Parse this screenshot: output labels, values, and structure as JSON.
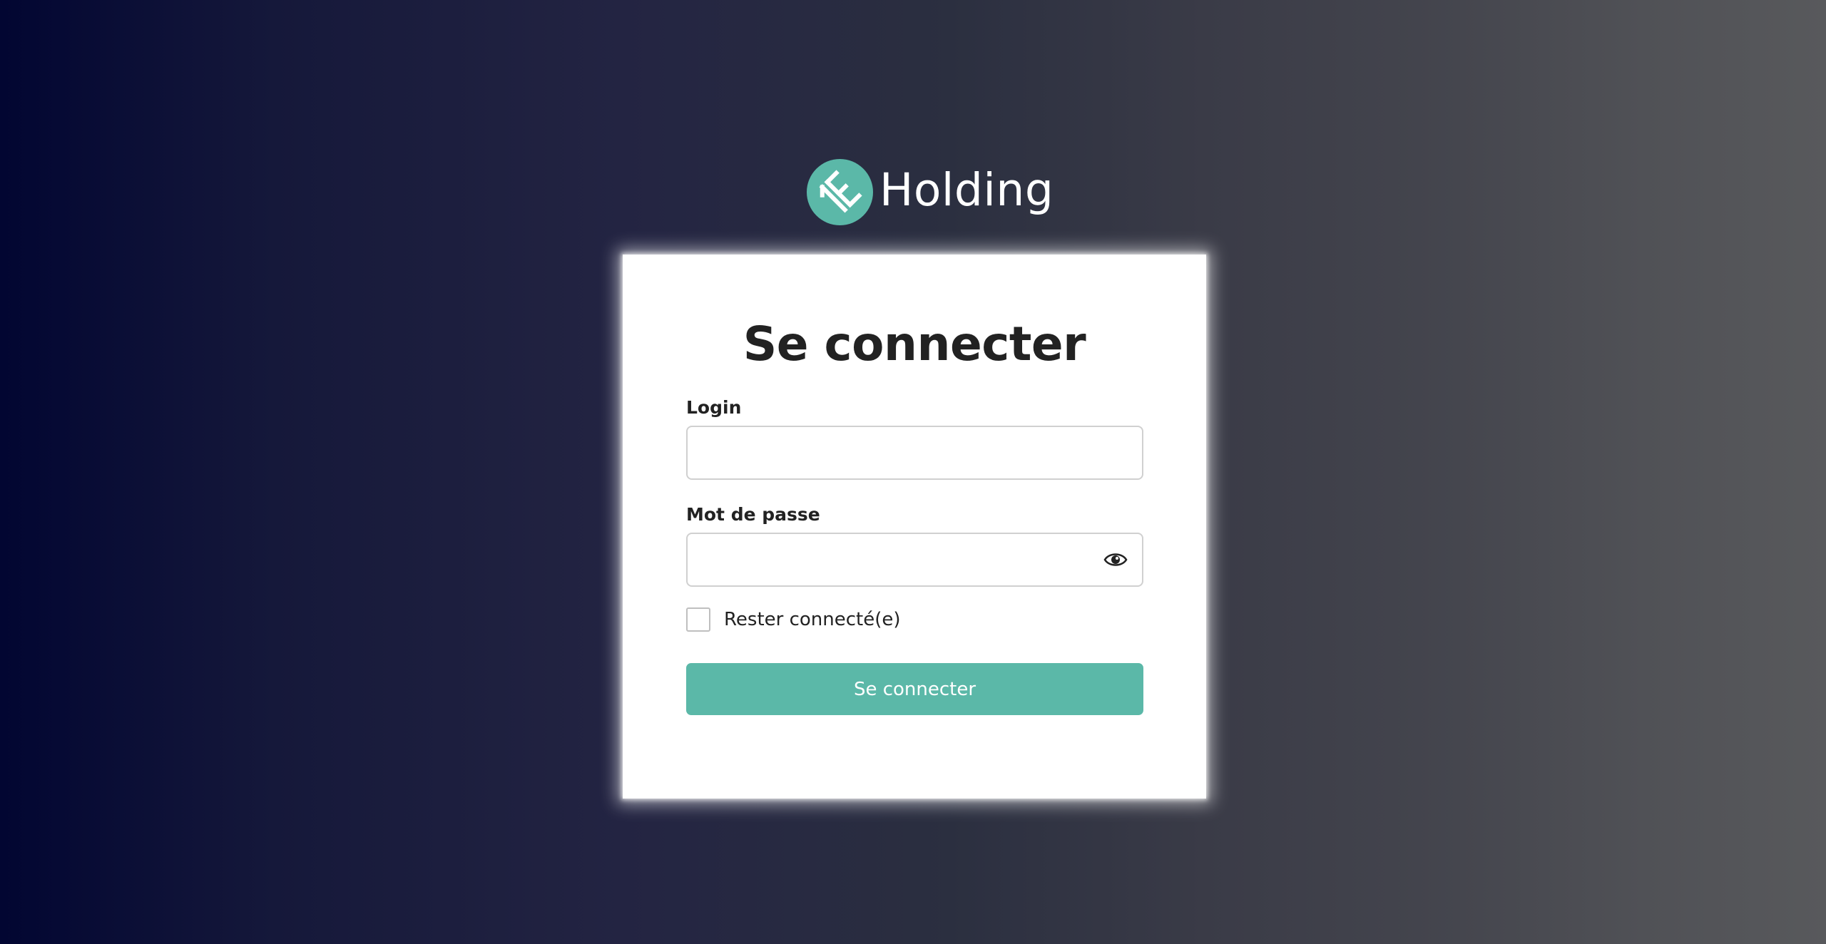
{
  "brand": {
    "name": "Holding",
    "logo_icon": "holding-e-logo-icon",
    "accent_color": "#5bb8a8"
  },
  "login_form": {
    "title": "Se connecter",
    "login_label": "Login",
    "login_value": "",
    "login_placeholder": "",
    "password_label": "Mot de passe",
    "password_value": "",
    "password_placeholder": "",
    "show_password_icon": "eye-icon",
    "remember_label": "Rester connecté(e)",
    "remember_checked": false,
    "submit_label": "Se connecter"
  }
}
